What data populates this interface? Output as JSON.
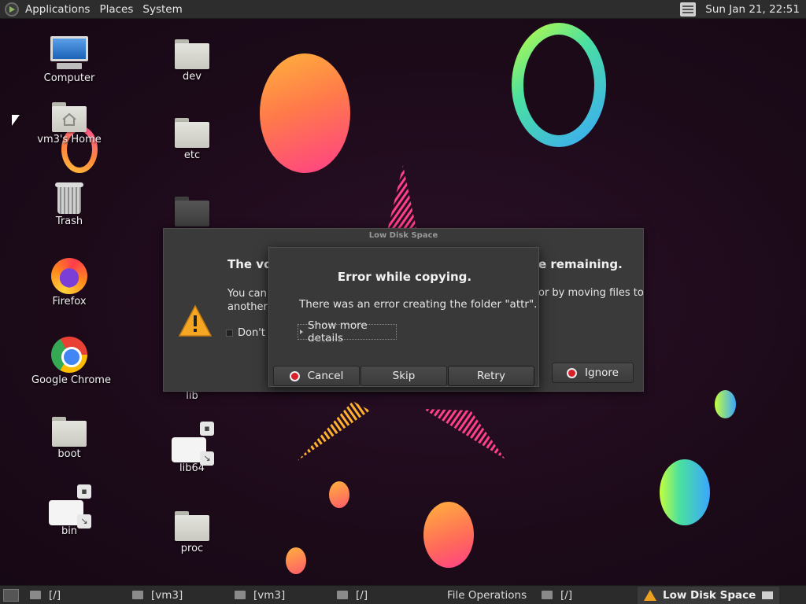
{
  "top_panel": {
    "menus": [
      "Applications",
      "Places",
      "System"
    ],
    "clock": "Sun Jan 21, 22:51"
  },
  "desktop_icons": [
    {
      "label": "Computer",
      "icon": "computer-icon"
    },
    {
      "label": "vm3's Home",
      "icon": "home-folder-icon"
    },
    {
      "label": "Trash",
      "icon": "trash-icon"
    },
    {
      "label": "Firefox",
      "icon": "firefox-icon"
    },
    {
      "label": "Google Chrome",
      "icon": "chrome-icon"
    },
    {
      "label": "boot",
      "icon": "folder-icon"
    },
    {
      "label": "bin",
      "icon": "symlink-icon"
    },
    {
      "label": "dev",
      "icon": "folder-icon"
    },
    {
      "label": "etc",
      "icon": "folder-icon"
    },
    {
      "label": "lib",
      "icon": "symlink-icon"
    },
    {
      "label": "lib64",
      "icon": "symlink-icon"
    },
    {
      "label": "proc",
      "icon": "folder-icon"
    }
  ],
  "low_disk_dialog": {
    "window_title": "Low Disk Space",
    "heading_start": "The vol",
    "heading_end": "e remaining.",
    "body_start_line1": "You can",
    "body_start_line2": "another",
    "body_end": "or by moving files to",
    "dont_show_label": "Don't s",
    "ignore_button": "Ignore"
  },
  "error_dialog": {
    "title": "Error while copying.",
    "message": "There was an error creating the folder \"attr\".",
    "details_toggle": "Show more details",
    "buttons": {
      "cancel": "Cancel",
      "skip": "Skip",
      "retry": "Retry"
    }
  },
  "taskbar": {
    "tasks": [
      {
        "label": "[/]",
        "icon": "folder-icon"
      },
      {
        "label": "[vm3]",
        "icon": "home-folder-icon"
      },
      {
        "label": "[vm3]",
        "icon": "home-folder-icon"
      },
      {
        "label": "[/]",
        "icon": "folder-icon"
      },
      {
        "label": "File Operations",
        "icon": "file-operations-icon"
      },
      {
        "label": "[/]",
        "icon": "folder-icon"
      },
      {
        "label": "Low Disk Space",
        "icon": "warning-icon",
        "active": true
      }
    ]
  },
  "colors": {
    "panel_bg": "#2d2d2d",
    "dialog_bg": "#393939",
    "stop_red": "#d91f2a",
    "warning_orange": "#f0a020"
  }
}
